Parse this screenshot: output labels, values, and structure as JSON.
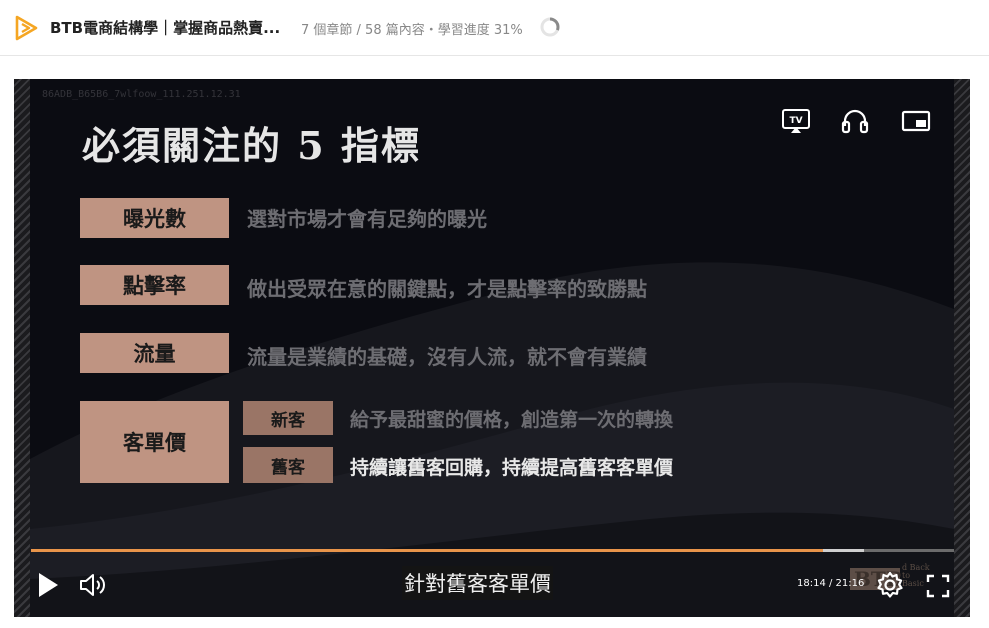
{
  "header": {
    "course_title": "BTB電商結構學｜掌握商品熱賣...",
    "progress_text": "7 個章節 / 58 篇內容・學習進度 31%",
    "progress_percent": 31,
    "brand_color": "#f5a623"
  },
  "player": {
    "watermark": "86ADB_B65B6_7wlfoow_111.251.12.31",
    "slide": {
      "title": "必須關注的 5 指標",
      "metrics": [
        {
          "label": "曝光數",
          "desc": "選對市場才會有足夠的曝光"
        },
        {
          "label": "點擊率",
          "desc": "做出受眾在意的關鍵點，才是點擊率的致勝點"
        },
        {
          "label": "流量",
          "desc": "流量是業績的基礎，沒有人流，就不會有業績"
        },
        {
          "label": "客單價"
        }
      ],
      "sub_metrics": [
        {
          "label": "新客",
          "desc": "給予最甜蜜的價格，創造第一次的轉換"
        },
        {
          "label": "舊客",
          "desc": "持續讓舊客回購，持續提高舊客客單價"
        }
      ]
    },
    "subtitle": "針對舊客客單價",
    "time": "18:14 / 21:16",
    "played_fraction": 0.8576,
    "buffered_fraction": 0.9025,
    "accent_color": "#e8944a",
    "icons": {
      "airplay": "airplay-tv-icon",
      "audio": "headphones-icon",
      "pip": "picture-in-picture-icon",
      "play": "play-icon",
      "volume": "volume-icon",
      "settings": "gear-icon",
      "fullscreen": "fullscreen-icon"
    },
    "logo_text": "BTB",
    "logo_subtext": "d Back\nto\nBasic"
  }
}
